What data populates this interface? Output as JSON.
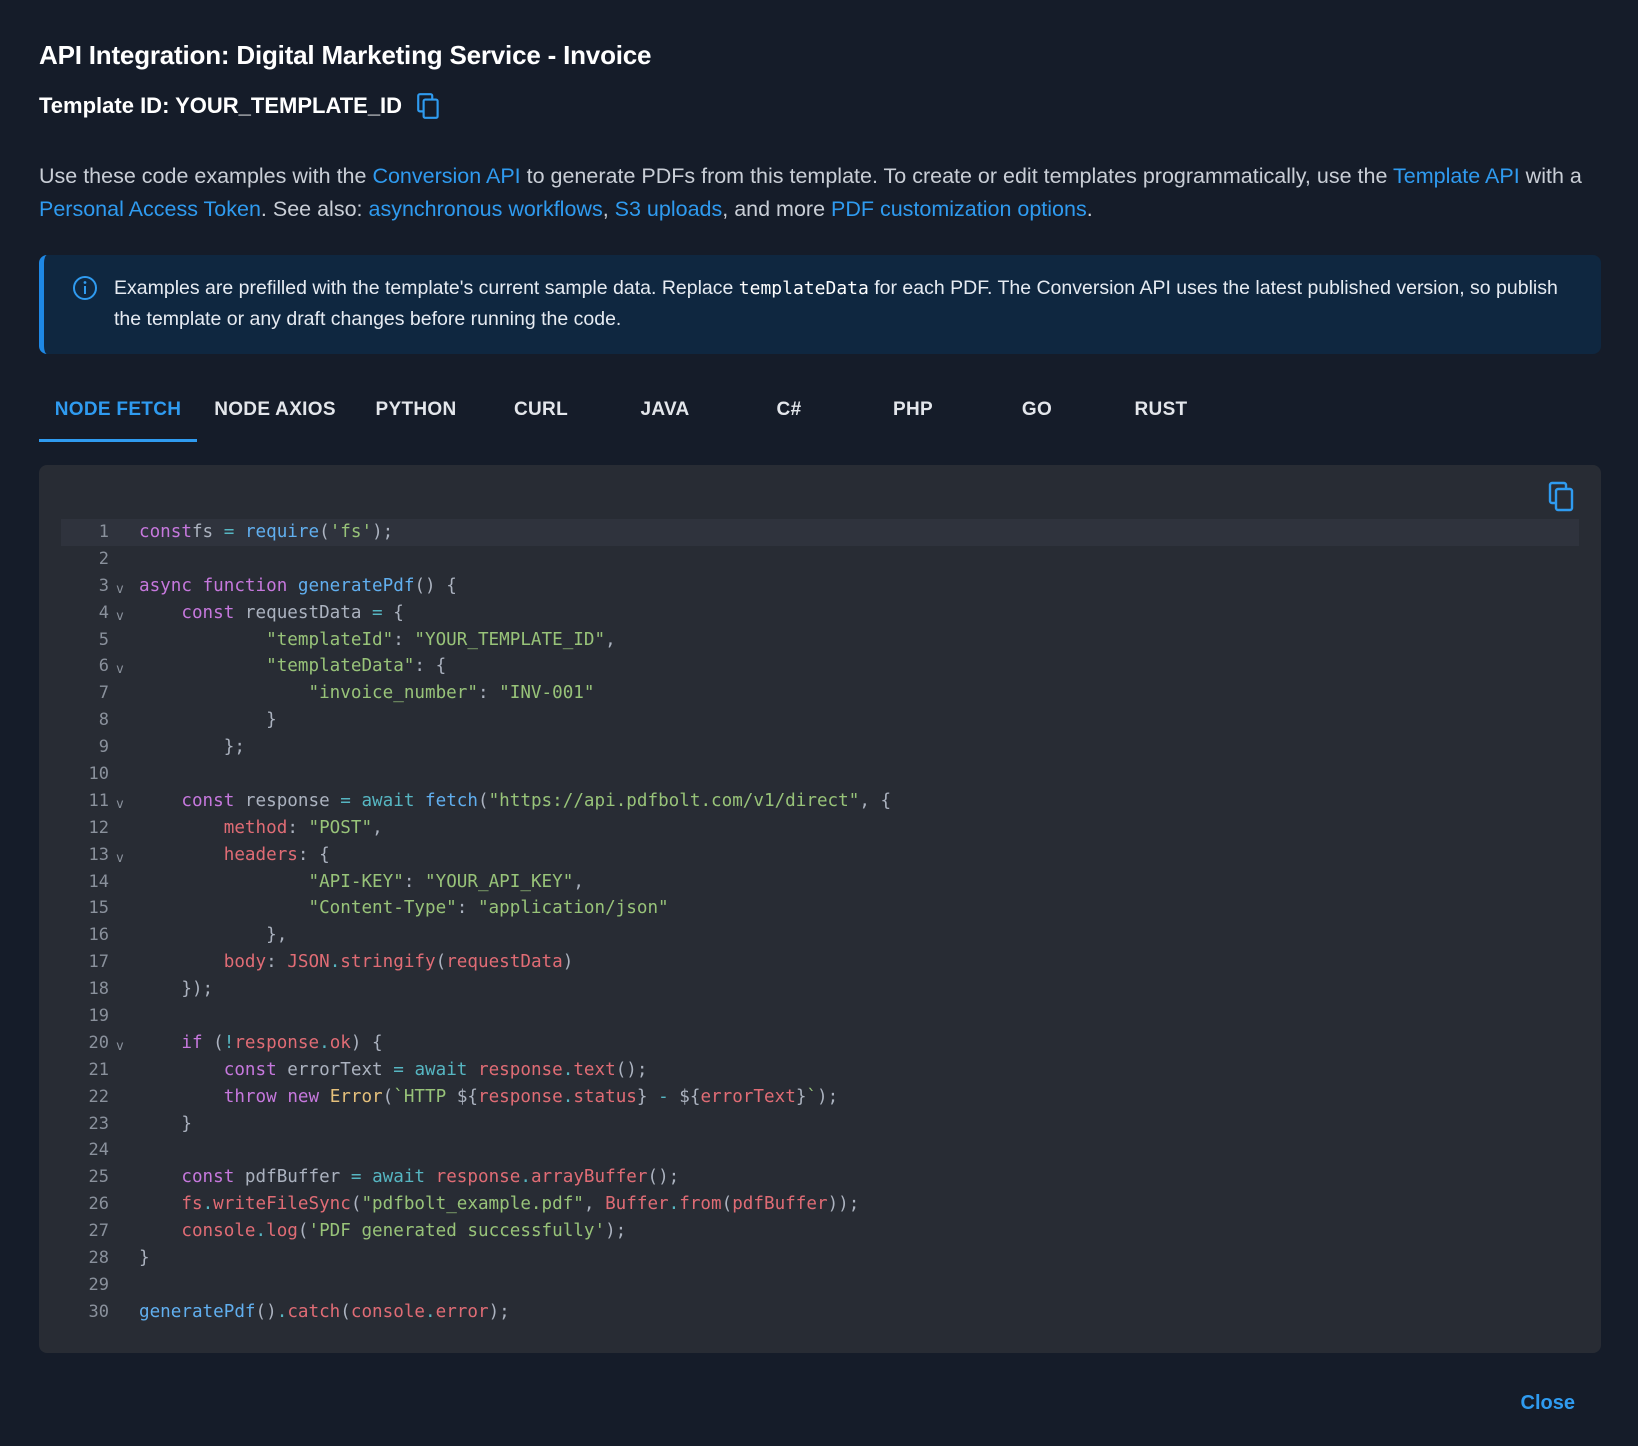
{
  "dialog": {
    "title": "API Integration: Digital Marketing Service - Invoice",
    "template_id_label": "Template ID: YOUR_TEMPLATE_ID",
    "copy_icon": "copy-icon",
    "close_label": "Close"
  },
  "intro": {
    "t1": "Use these code examples with the ",
    "link_conversion_api": "Conversion API",
    "t2": " to generate PDFs from this template. To create or edit templates programmatically, use the ",
    "link_template_api": "Template API",
    "t3": " with a ",
    "link_pat": "Personal Access Token",
    "t4": ". See also: ",
    "link_async": "asynchronous workflows",
    "t5": ", ",
    "link_s3": "S3 uploads",
    "t6": ", and more ",
    "link_pdf_options": "PDF customization options",
    "t7": "."
  },
  "info": {
    "icon": "info-icon",
    "t1": "Examples are prefilled with the template's current sample data. Replace ",
    "code": "templateData",
    "t2": " for each PDF. The Conversion API uses the latest published version, so publish the template or any draft changes before running the code."
  },
  "tabs": [
    {
      "label": "NODE FETCH",
      "active": true
    },
    {
      "label": "NODE AXIOS",
      "active": false
    },
    {
      "label": "PYTHON",
      "active": false
    },
    {
      "label": "CURL",
      "active": false
    },
    {
      "label": "JAVA",
      "active": false
    },
    {
      "label": "C#",
      "active": false
    },
    {
      "label": "PHP",
      "active": false
    },
    {
      "label": "GO",
      "active": false
    },
    {
      "label": "RUST",
      "active": false
    }
  ],
  "colors": {
    "accent": "#2f9bf0",
    "background": "#151c29",
    "code_background": "#282c34",
    "info_background": "#0f2740"
  },
  "code": {
    "copy_icon": "copy-icon",
    "highlighted_line": 1,
    "fold_lines": [
      3,
      4,
      6,
      11,
      13,
      20
    ],
    "lines": [
      [
        [
          "kw",
          "const"
        ],
        [
          "",
          "fs"
        ],
        [
          "op",
          " = "
        ],
        [
          "fn",
          "require"
        ],
        [
          "",
          "("
        ],
        [
          "str",
          "'fs'"
        ],
        [
          "",
          ");"
        ]
      ],
      [],
      [
        [
          "kw",
          "async"
        ],
        [
          "",
          " "
        ],
        [
          "kw",
          "function"
        ],
        [
          "",
          " "
        ],
        [
          "fn",
          "generatePdf"
        ],
        [
          "",
          "() {"
        ]
      ],
      [
        [
          "",
          "    "
        ],
        [
          "kw",
          "const"
        ],
        [
          "",
          " requestData "
        ],
        [
          "op",
          "="
        ],
        [
          "",
          " {"
        ]
      ],
      [
        [
          "",
          "            "
        ],
        [
          "str",
          "\"templateId\""
        ],
        [
          "",
          ": "
        ],
        [
          "str",
          "\"YOUR_TEMPLATE_ID\""
        ],
        [
          "",
          ","
        ]
      ],
      [
        [
          "",
          "            "
        ],
        [
          "str",
          "\"templateData\""
        ],
        [
          "",
          ": {"
        ]
      ],
      [
        [
          "",
          "                "
        ],
        [
          "str",
          "\"invoice_number\""
        ],
        [
          "",
          ": "
        ],
        [
          "str",
          "\"INV-001\""
        ]
      ],
      [
        [
          "",
          "            }"
        ]
      ],
      [
        [
          "",
          "        };"
        ]
      ],
      [],
      [
        [
          "",
          "    "
        ],
        [
          "kw",
          "const"
        ],
        [
          "",
          " response "
        ],
        [
          "op",
          "="
        ],
        [
          "",
          " "
        ],
        [
          "op",
          "await"
        ],
        [
          "",
          " "
        ],
        [
          "fn",
          "fetch"
        ],
        [
          "",
          "("
        ],
        [
          "str",
          "\"https://api.pdfbolt.com/v1/direct\""
        ],
        [
          "",
          ", {"
        ]
      ],
      [
        [
          "",
          "        "
        ],
        [
          "prop",
          "method"
        ],
        [
          "",
          ": "
        ],
        [
          "str",
          "\"POST\""
        ],
        [
          "",
          ","
        ]
      ],
      [
        [
          "",
          "        "
        ],
        [
          "prop",
          "headers"
        ],
        [
          "",
          ": {"
        ]
      ],
      [
        [
          "",
          "                "
        ],
        [
          "str",
          "\"API-KEY\""
        ],
        [
          "",
          ": "
        ],
        [
          "str",
          "\"YOUR_API_KEY\""
        ],
        [
          "",
          ","
        ]
      ],
      [
        [
          "",
          "                "
        ],
        [
          "str",
          "\"Content-Type\""
        ],
        [
          "",
          ": "
        ],
        [
          "str",
          "\"application/json\""
        ]
      ],
      [
        [
          "",
          "            },"
        ]
      ],
      [
        [
          "",
          "        "
        ],
        [
          "prop",
          "body"
        ],
        [
          "",
          ": "
        ],
        [
          "prop",
          "JSON"
        ],
        [
          "op",
          "."
        ],
        [
          "prop",
          "stringify"
        ],
        [
          "",
          "("
        ],
        [
          "prop",
          "requestData"
        ],
        [
          "",
          ")"
        ]
      ],
      [
        [
          "",
          "    });"
        ]
      ],
      [],
      [
        [
          "",
          "    "
        ],
        [
          "kw",
          "if"
        ],
        [
          "",
          " ("
        ],
        [
          "op",
          "!"
        ],
        [
          "prop",
          "response"
        ],
        [
          "op",
          "."
        ],
        [
          "prop",
          "ok"
        ],
        [
          "",
          ") {"
        ]
      ],
      [
        [
          "",
          "        "
        ],
        [
          "kw",
          "const"
        ],
        [
          "",
          " errorText "
        ],
        [
          "op",
          "="
        ],
        [
          "",
          " "
        ],
        [
          "op",
          "await"
        ],
        [
          "",
          " "
        ],
        [
          "prop",
          "response"
        ],
        [
          "op",
          "."
        ],
        [
          "prop",
          "text"
        ],
        [
          "",
          "();"
        ]
      ],
      [
        [
          "",
          "        "
        ],
        [
          "kw",
          "throw"
        ],
        [
          "",
          " "
        ],
        [
          "kw",
          "new"
        ],
        [
          "",
          " "
        ],
        [
          "cls",
          "Error"
        ],
        [
          "",
          "("
        ],
        [
          "str",
          "`HTTP "
        ],
        [
          "",
          "${"
        ],
        [
          "prop",
          "response"
        ],
        [
          "op",
          "."
        ],
        [
          "prop",
          "status"
        ],
        [
          "",
          "}"
        ],
        [
          "op",
          " - "
        ],
        [
          "",
          "${"
        ],
        [
          "prop",
          "errorText"
        ],
        [
          "",
          "}"
        ],
        [
          "str",
          "`"
        ],
        [
          "",
          ");"
        ]
      ],
      [
        [
          "",
          "    }"
        ]
      ],
      [],
      [
        [
          "",
          "    "
        ],
        [
          "kw",
          "const"
        ],
        [
          "",
          " pdfBuffer "
        ],
        [
          "op",
          "="
        ],
        [
          "",
          " "
        ],
        [
          "op",
          "await"
        ],
        [
          "",
          " "
        ],
        [
          "prop",
          "response"
        ],
        [
          "op",
          "."
        ],
        [
          "prop",
          "arrayBuffer"
        ],
        [
          "",
          "();"
        ]
      ],
      [
        [
          "",
          "    "
        ],
        [
          "prop",
          "fs"
        ],
        [
          "op",
          "."
        ],
        [
          "prop",
          "writeFileSync"
        ],
        [
          "",
          "("
        ],
        [
          "str",
          "\"pdfbolt_example.pdf\""
        ],
        [
          "",
          ", "
        ],
        [
          "prop",
          "Buffer"
        ],
        [
          "op",
          "."
        ],
        [
          "prop",
          "from"
        ],
        [
          "",
          "("
        ],
        [
          "prop",
          "pdfBuffer"
        ],
        [
          "",
          "));"
        ]
      ],
      [
        [
          "",
          "    "
        ],
        [
          "prop",
          "console"
        ],
        [
          "op",
          "."
        ],
        [
          "prop",
          "log"
        ],
        [
          "",
          "("
        ],
        [
          "str",
          "'PDF generated successfully'"
        ],
        [
          "",
          ");"
        ]
      ],
      [
        [
          "",
          "}"
        ]
      ],
      [],
      [
        [
          "fn",
          "generatePdf"
        ],
        [
          "",
          "()"
        ],
        [
          "op",
          "."
        ],
        [
          "prop",
          "catch"
        ],
        [
          "",
          "("
        ],
        [
          "prop",
          "console"
        ],
        [
          "op",
          "."
        ],
        [
          "prop",
          "error"
        ],
        [
          "",
          ");"
        ]
      ]
    ]
  }
}
